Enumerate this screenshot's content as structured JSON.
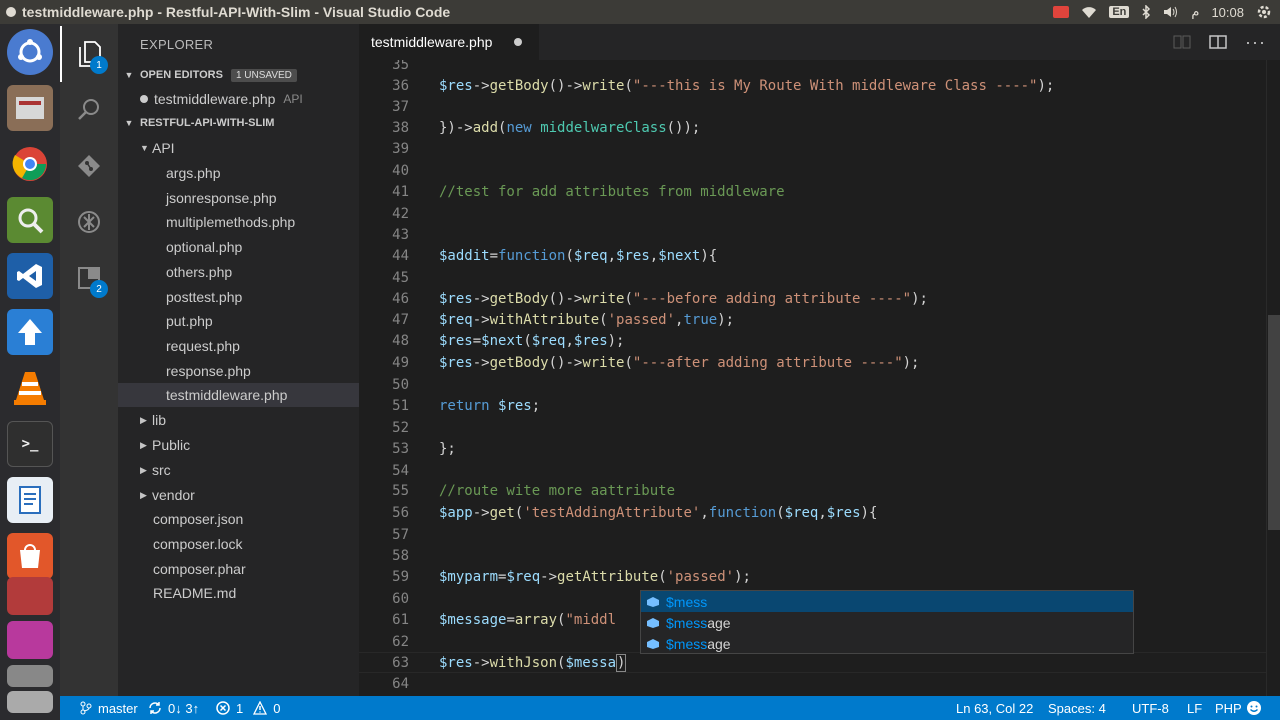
{
  "window": {
    "title": "testmiddleware.php - Restful-API-With-Slim - Visual Studio Code"
  },
  "tray": {
    "keyboard": "En",
    "clock_suffix": "م",
    "clock": "10:08"
  },
  "launcher": {
    "apps": [
      "ubuntu-dash",
      "files",
      "chrome",
      "image-viewer",
      "vscode",
      "software-updater",
      "vlc",
      "terminal",
      "text-editor",
      "app-store",
      "app-1",
      "app-2",
      "app-3",
      "app-4"
    ]
  },
  "activity_bar": {
    "explorer_badge": "1",
    "extensions_badge": "2"
  },
  "explorer": {
    "title": "EXPLORER",
    "open_editors": {
      "label": "OPEN EDITORS",
      "badge": "1 UNSAVED",
      "file": "testmiddleware.php",
      "hint": "API"
    },
    "project": {
      "label": "RESTFUL-API-WITH-SLIM",
      "api_folder": "API",
      "api_files": [
        "args.php",
        "jsonresponse.php",
        "multiplemethods.php",
        "optional.php",
        "others.php",
        "posttest.php",
        "put.php",
        "request.php",
        "response.php",
        "testmiddleware.php"
      ],
      "folders": [
        "lib",
        "Public",
        "src",
        "vendor"
      ],
      "root_files": [
        "composer.json",
        "composer.lock",
        "composer.phar",
        "README.md"
      ]
    }
  },
  "tab": {
    "label": "testmiddleware.php"
  },
  "code": {
    "line_numbers": [
      "35",
      "36",
      "37",
      "38",
      "39",
      "40",
      "41",
      "42",
      "43",
      "44",
      "45",
      "46",
      "47",
      "48",
      "49",
      "50",
      "51",
      "52",
      "53",
      "54",
      "55",
      "56",
      "57",
      "58",
      "59",
      "60",
      "61",
      "62",
      "63",
      "64"
    ],
    "l36_a": "$res",
    "l36_b": "->",
    "l36_c": "getBody",
    "l36_d": "()->",
    "l36_e": "write",
    "l36_f": "(",
    "l36_g": "\"---this is My Route With middleware Class ----\"",
    "l36_h": ");",
    "l38_a": "})->",
    "l38_b": "add",
    "l38_c": "(",
    "l38_d": "new",
    "l38_e": " ",
    "l38_f": "middelwareClass",
    "l38_g": "());",
    "l41": "//test for add attributes from middleware",
    "l44_a": "$addit",
    "l44_b": "=",
    "l44_c": "function",
    "l44_d": "(",
    "l44_e": "$req",
    "l44_f": ",",
    "l44_g": "$res",
    "l44_h": ",",
    "l44_i": "$next",
    "l44_j": "){",
    "l46_a": "$res",
    "l46_b": "->",
    "l46_c": "getBody",
    "l46_d": "()->",
    "l46_e": "write",
    "l46_f": "(",
    "l46_g": "\"---before adding attribute ----\"",
    "l46_h": ");",
    "l47_a": "$req",
    "l47_b": "->",
    "l47_c": "withAttribute",
    "l47_d": "(",
    "l47_e": "'passed'",
    "l47_f": ",",
    "l47_g": "true",
    "l47_h": ");",
    "l48_a": "$res",
    "l48_b": "=",
    "l48_c": "$next",
    "l48_d": "(",
    "l48_e": "$req",
    "l48_f": ",",
    "l48_g": "$res",
    "l48_h": ");",
    "l49_a": "$res",
    "l49_b": "->",
    "l49_c": "getBody",
    "l49_d": "()->",
    "l49_e": "write",
    "l49_f": "(",
    "l49_g": "\"---after adding attribute ----\"",
    "l49_h": ");",
    "l51_a": "return",
    "l51_b": " ",
    "l51_c": "$res",
    "l51_d": ";",
    "l53": "};",
    "l55": "//route wite more aattribute",
    "l56_a": "$app",
    "l56_b": "->",
    "l56_c": "get",
    "l56_d": "(",
    "l56_e": "'testAddingAttribute'",
    "l56_f": ",",
    "l56_g": "function",
    "l56_h": "(",
    "l56_i": "$req",
    "l56_j": ",",
    "l56_k": "$res",
    "l56_l": "){",
    "l59_a": "$myparm",
    "l59_b": "=",
    "l59_c": "$req",
    "l59_d": "->",
    "l59_e": "getAttribute",
    "l59_f": "(",
    "l59_g": "'passed'",
    "l59_h": ");",
    "l61_a": "$message",
    "l61_b": "=",
    "l61_c": "array",
    "l61_d": "(",
    "l61_e": "\"middl",
    "l63_a": "$res",
    "l63_b": "->",
    "l63_c": "withJson",
    "l63_d": "(",
    "l63_e": "$messa",
    "l63_f": ")"
  },
  "suggest": {
    "items": [
      {
        "match": "$mess",
        "rest": ""
      },
      {
        "match": "$mess",
        "rest": "age"
      },
      {
        "match": "$mess",
        "rest": "age"
      }
    ]
  },
  "statusbar": {
    "branch": "master",
    "sync": "0↓ 3↑",
    "errors": "1",
    "warnings": "0",
    "position": "Ln 63, Col 22",
    "spaces": "Spaces: 4",
    "encoding": "UTF-8",
    "eol": "LF",
    "language": "PHP"
  },
  "colors": {
    "accent": "#007acc",
    "suggest_focus": "#094771",
    "variable": "#9cdcfe",
    "string": "#ce9178",
    "keyword": "#569cd6",
    "comment": "#6a9955"
  }
}
